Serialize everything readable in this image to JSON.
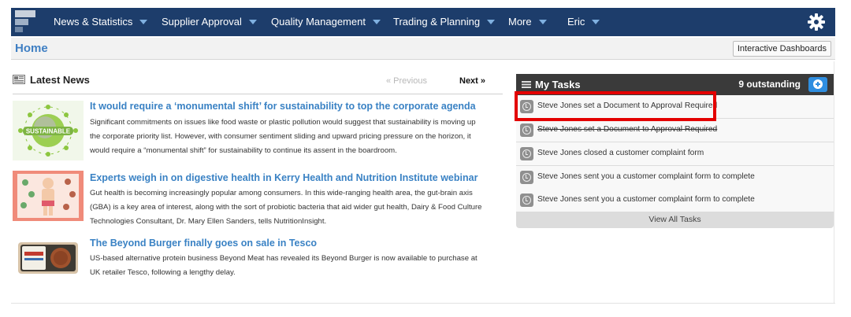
{
  "nav": {
    "items": [
      {
        "label": "News & Statistics"
      },
      {
        "label": "Supplier Approval"
      },
      {
        "label": "Quality Management"
      },
      {
        "label": "Trading & Planning"
      },
      {
        "label": "More"
      },
      {
        "label": "Eric"
      }
    ],
    "settings_icon": "gear-icon",
    "colors": {
      "bar": "#1d3d6b",
      "caret": "#7fb0e0"
    }
  },
  "home": {
    "title": "Home",
    "dashboards_button": "Interactive Dashboards"
  },
  "news": {
    "title": "Latest News",
    "prev_label": "« Previous",
    "next_label": "Next »",
    "articles": [
      {
        "title": "It would require a ‘monumental shift’ for sustainability to top the corporate agenda",
        "body": "Significant commitments on issues like food waste or plastic pollution would suggest that sustainability is moving up the corporate priority list. However, with consumer sentiment sliding and upward pricing pressure on the horizon, it would require a “monumental shift” for sustainability to continue its assent in the boardroom.",
        "thumb_text": "SUSTAINABLE"
      },
      {
        "title": "Experts weigh in on digestive health in Kerry Health and Nutrition Institute webinar",
        "body": "Gut health is becoming increasingly popular among consumers. In this wide-ranging health area, the gut-brain axis (GBA) is a key area of interest, along with the sort of probiotic bacteria that aid wider gut health, Dairy & Food Culture Technologies Consultant, Dr. Mary Ellen Sanders, tells NutritionInsight."
      },
      {
        "title": "The Beyond Burger finally goes on sale in Tesco",
        "body": "US-based alternative protein business Beyond Meat has revealed its Beyond Burger is now available to purchase at UK retailer Tesco, following a lengthy delay."
      }
    ]
  },
  "tasks": {
    "title": "My Tasks",
    "count_label": "9 outstanding",
    "items": [
      {
        "text": "Steve Jones set a Document to Approval Required",
        "struck": false
      },
      {
        "text": "Steve Jones set a Document to Approval Required",
        "struck": true
      },
      {
        "text": "Steve Jones closed a customer complaint form",
        "struck": false
      },
      {
        "text": "Steve Jones sent you a customer complaint form to complete",
        "struck": false
      },
      {
        "text": "Steve Jones sent you a customer complaint form to complete",
        "struck": false
      }
    ],
    "view_all": "View All Tasks",
    "colors": {
      "header": "#3a3a3a",
      "add_button": "#2f8ee0",
      "highlight": "#e30000"
    }
  }
}
